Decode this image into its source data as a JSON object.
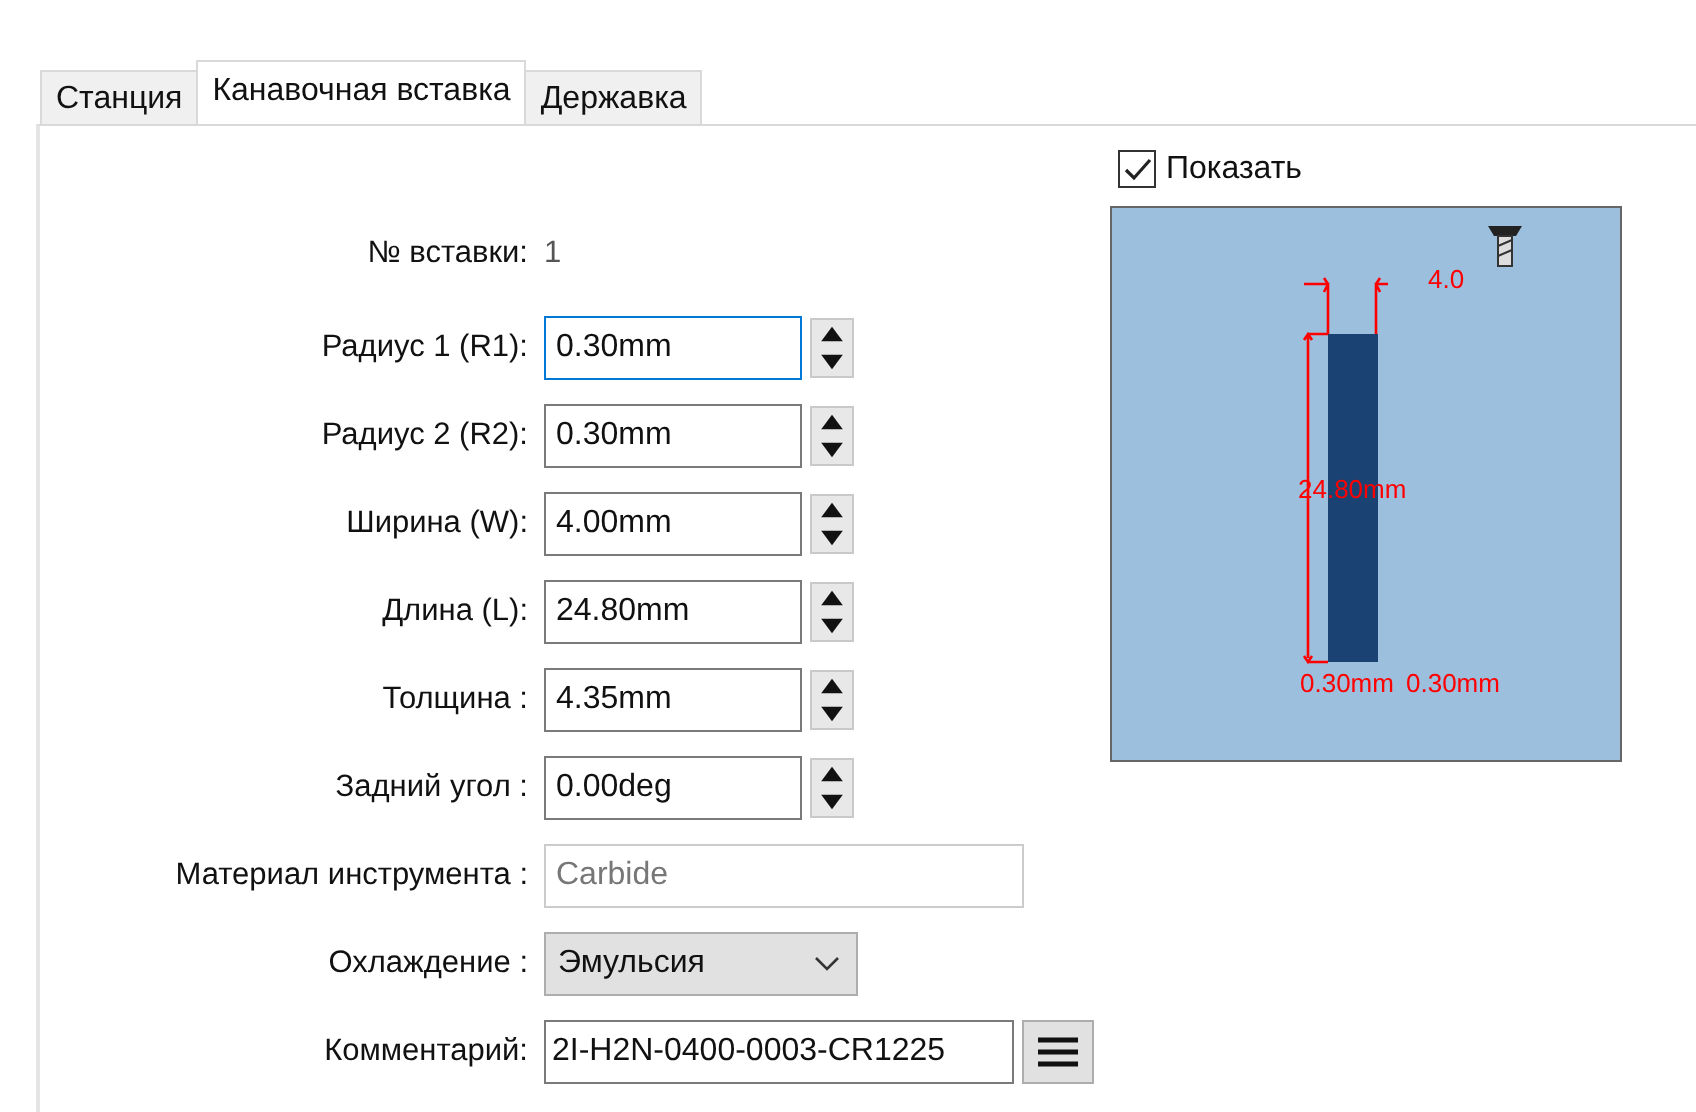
{
  "tabs": [
    {
      "label": "Станция",
      "selected": false
    },
    {
      "label": "Канавочная вставка",
      "selected": true
    },
    {
      "label": "Державка",
      "selected": false
    }
  ],
  "fields": [
    {
      "kind": "readonly",
      "label": "№ вставки:",
      "value": "1"
    },
    {
      "kind": "spin",
      "label": "Радиус 1 (R1):",
      "value": "0.30mm",
      "focused": true
    },
    {
      "kind": "spin",
      "label": "Радиус 2 (R2):",
      "value": "0.30mm",
      "focused": false
    },
    {
      "kind": "spin",
      "label": "Ширина (W):",
      "value": "4.00mm",
      "focused": false
    },
    {
      "kind": "spin",
      "label": "Длина (L):",
      "value": "24.80mm",
      "focused": false
    },
    {
      "kind": "spin",
      "label": "Толщина :",
      "value": "4.35mm",
      "focused": false
    },
    {
      "kind": "spin",
      "label": "Задний угол :",
      "value": "0.00deg",
      "focused": false
    },
    {
      "kind": "text",
      "label": "Материал инструмента :",
      "value": "Carbide",
      "disabled": true
    },
    {
      "kind": "combo",
      "label": "Охлаждение :",
      "value": "Эмульсия"
    },
    {
      "kind": "comment",
      "label": "Комментарий:",
      "value": "2I-H2N-0400-0003-CR1225"
    }
  ],
  "preview": {
    "show": {
      "label": "Показать",
      "checked": true
    },
    "width_label": "4.0",
    "length_label": "24.80mm",
    "radius_labels": [
      "0.30mm",
      "0.30mm"
    ]
  }
}
